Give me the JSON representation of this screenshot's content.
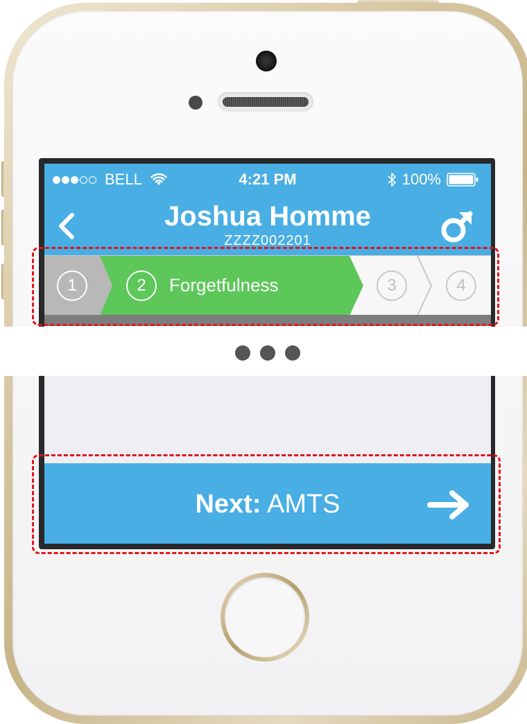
{
  "status_bar": {
    "signal": "●●●○○",
    "carrier": "BELL",
    "time": "4:21 PM",
    "battery": "100%"
  },
  "header": {
    "title": "Joshua Homme",
    "subtitle": "ZZZZ002201"
  },
  "stepper": {
    "steps": [
      {
        "number": "1",
        "state": "completed"
      },
      {
        "number": "2",
        "state": "active",
        "label": "Forgetfulness"
      },
      {
        "number": "3",
        "state": "upcoming"
      },
      {
        "number": "4",
        "state": "upcoming"
      }
    ]
  },
  "next_button": {
    "prefix": "Next:",
    "label": "AMTS"
  },
  "colors": {
    "header_blue": "#49aee3",
    "active_green": "#5dc75a",
    "completed_gray": "#b8b8b8",
    "highlight_red": "#e0141b"
  },
  "icons": {
    "back": "chevron-left-icon",
    "gender": "male-icon",
    "next": "arrow-right-icon",
    "wifi": "wifi-icon",
    "bluetooth": "bluetooth-icon",
    "battery": "battery-icon"
  }
}
